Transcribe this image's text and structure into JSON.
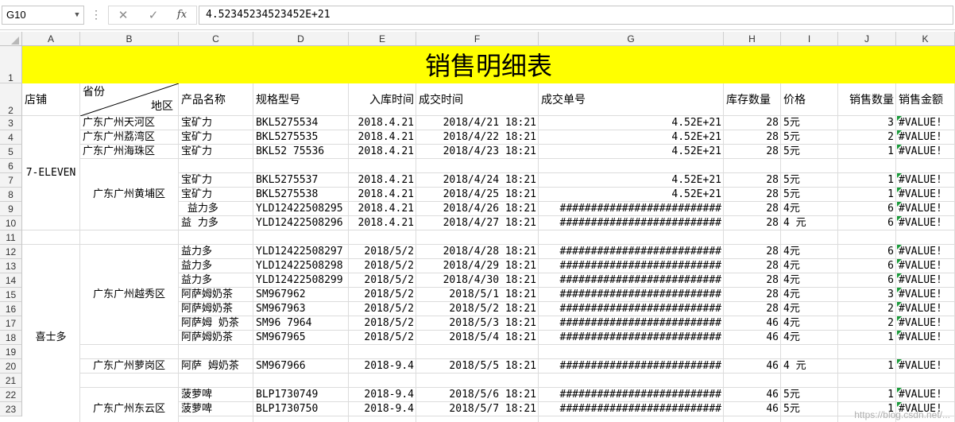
{
  "formula_bar": {
    "name_box": "G10",
    "formula": "4.52345234523452E+21",
    "fx_label": "fx",
    "cancel_glyph": "✕",
    "enter_glyph": "✓"
  },
  "columns": [
    "A",
    "B",
    "C",
    "D",
    "E",
    "F",
    "G",
    "H",
    "I",
    "J",
    "K"
  ],
  "title": "销售明细表",
  "headers": {
    "store": "店铺",
    "province": "省份",
    "district": "地区",
    "product": "产品名称",
    "spec": "规格型号",
    "in_date": "入库时间",
    "deal_time": "成交时间",
    "order_no": "成交单号",
    "stock": "库存数量",
    "price": "价格",
    "sales_qty": "销售数量",
    "sales_amount": "销售金额"
  },
  "stores": [
    "7-ELEVEN",
    "喜士多"
  ],
  "areas": [
    "广东广州黄埔区",
    "广东广州越秀区",
    "广东广州萝岗区",
    "广东广州东云区"
  ],
  "rows": [
    {
      "n": "3",
      "b": "广东广州天河区",
      "c": "宝矿力",
      "d": "BKL5275534",
      "e": "2018.4.21",
      "f": "2018/4/21 18:21",
      "g": "4.52E+21",
      "h": "28",
      "i": "5元",
      "j": "3",
      "k": "#VALUE!"
    },
    {
      "n": "4",
      "b": "广东广州荔湾区",
      "c": "宝矿力",
      "d": "BKL5275535",
      "e": "2018.4.21",
      "f": "2018/4/22 18:21",
      "g": "4.52E+21",
      "h": "28",
      "i": "5元",
      "j": "2",
      "k": "#VALUE!"
    },
    {
      "n": "5",
      "b": "广东广州海珠区",
      "c": "宝矿力",
      "d": "BKL52 75536",
      "e": "2018.4.21",
      "f": "2018/4/23 18:21",
      "g": "4.52E+21",
      "h": "28",
      "i": "5元",
      "j": "1",
      "k": "#VALUE!"
    },
    {
      "n": "6",
      "b": "",
      "c": "",
      "d": "",
      "e": "",
      "f": "",
      "g": "",
      "h": "",
      "i": "",
      "j": "",
      "k": ""
    },
    {
      "n": "7",
      "b": "",
      "c": "宝矿力",
      "d": "BKL5275537",
      "e": "2018.4.21",
      "f": "2018/4/24 18:21",
      "g": "4.52E+21",
      "h": "28",
      "i": "5元",
      "j": "1",
      "k": "#VALUE!"
    },
    {
      "n": "8",
      "b": "",
      "c": "宝矿力",
      "d": "BKL5275538",
      "e": "2018.4.21",
      "f": "2018/4/25 18:21",
      "g": "4.52E+21",
      "h": "28",
      "i": "5元",
      "j": "1",
      "k": "#VALUE!"
    },
    {
      "n": "9",
      "b": "",
      "c": " 益力多",
      "d": "YLD12422508295",
      "e": "2018.4.21",
      "f": "2018/4/26 18:21",
      "g": "##########################",
      "h": "28",
      "i": "4元",
      "j": "6",
      "k": "#VALUE!"
    },
    {
      "n": "10",
      "b": "",
      "c": "益 力多",
      "d": "YLD12422508296",
      "e": "2018.4.21",
      "f": "2018/4/27 18:21",
      "g": "##########################",
      "h": "28",
      "i": "4 元",
      "j": "6",
      "k": "#VALUE!"
    },
    {
      "n": "11",
      "b": "",
      "c": "",
      "d": "",
      "e": "",
      "f": "",
      "g": "",
      "h": "",
      "i": "",
      "j": "",
      "k": ""
    },
    {
      "n": "12",
      "b": "",
      "c": "益力多",
      "d": "YLD12422508297",
      "e": "2018/5/2",
      "f": "2018/4/28 18:21",
      "g": "##########################",
      "h": "28",
      "i": "4元",
      "j": "6",
      "k": "#VALUE!"
    },
    {
      "n": "13",
      "b": "",
      "c": "益力多",
      "d": "YLD12422508298",
      "e": "2018/5/2",
      "f": "2018/4/29 18:21",
      "g": "##########################",
      "h": "28",
      "i": "4元",
      "j": "6",
      "k": "#VALUE!"
    },
    {
      "n": "14",
      "b": "",
      "c": "益力多",
      "d": "YLD12422508299",
      "e": "2018/5/2",
      "f": "2018/4/30 18:21",
      "g": "##########################",
      "h": "28",
      "i": "4元",
      "j": "6",
      "k": "#VALUE!"
    },
    {
      "n": "15",
      "b": "",
      "c": "阿萨姆奶茶",
      "d": "SM967962",
      "e": "2018/5/2",
      "f": "2018/5/1 18:21",
      "g": "##########################",
      "h": "28",
      "i": "4元",
      "j": "3",
      "k": "#VALUE!"
    },
    {
      "n": "16",
      "b": "",
      "c": "阿萨姆奶茶",
      "d": "SM967963",
      "e": "2018/5/2",
      "f": "2018/5/2 18:21",
      "g": "##########################",
      "h": "28",
      "i": "4元",
      "j": "2",
      "k": "#VALUE!"
    },
    {
      "n": "17",
      "b": "",
      "c": "阿萨姆 奶茶",
      "d": "SM96 7964",
      "e": "2018/5/2",
      "f": "2018/5/3 18:21",
      "g": "##########################",
      "h": "46",
      "i": "4元",
      "j": "2",
      "k": "#VALUE!"
    },
    {
      "n": "18",
      "b": "",
      "c": "阿萨姆奶茶",
      "d": "SM967965",
      "e": "2018/5/2",
      "f": "2018/5/4 18:21",
      "g": "##########################",
      "h": "46",
      "i": "4元",
      "j": "1",
      "k": "#VALUE!"
    },
    {
      "n": "19",
      "b": "",
      "c": "",
      "d": "",
      "e": "",
      "f": "",
      "g": "",
      "h": "",
      "i": "",
      "j": "",
      "k": ""
    },
    {
      "n": "20",
      "b": "",
      "c": "阿萨 姆奶茶",
      "d": "SM967966",
      "e": "2018-9.4",
      "f": "2018/5/5 18:21",
      "g": "##########################",
      "h": "46",
      "i": "4 元",
      "j": "1",
      "k": "#VALUE!"
    },
    {
      "n": "21",
      "b": "",
      "c": "",
      "d": "",
      "e": "",
      "f": "",
      "g": "",
      "h": "",
      "i": "",
      "j": "",
      "k": ""
    },
    {
      "n": "22",
      "b": "",
      "c": "菠萝啤",
      "d": "BLP1730749",
      "e": "2018-9.4",
      "f": "2018/5/6 18:21",
      "g": "##########################",
      "h": "46",
      "i": "5元",
      "j": "1",
      "k": "#VALUE!"
    },
    {
      "n": "23",
      "b": "",
      "c": "菠萝啤",
      "d": "BLP1730750",
      "e": "2018-9.4",
      "f": "2018/5/7 18:21",
      "g": "##########################",
      "h": "46",
      "i": "5元",
      "j": "1",
      "k": "#VALUE!"
    }
  ],
  "watermark": "https://blog.csdn.net/..."
}
